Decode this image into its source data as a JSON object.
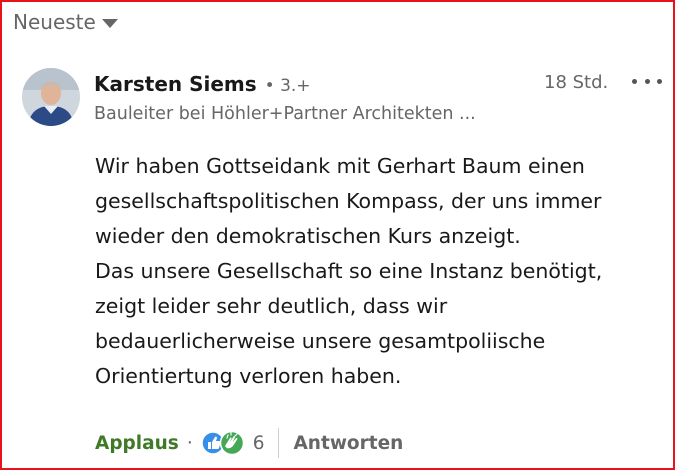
{
  "sort": {
    "label": "Neueste"
  },
  "comment": {
    "author": "Karsten Siems",
    "degree": "• 3.+",
    "headline": "Bauleiter bei Höhler+Partner Architekten ...",
    "time": "18 Std.",
    "body_lines": [
      "Wir haben Gottseidank mit Gerhart Baum einen",
      "gesellschaftspolitischen Kompass, der uns immer",
      "wieder den demokratischen Kurs anzeigt.",
      "Das unsere Gesellschaft so eine Instanz benötigt,",
      "zeigt leider sehr deutlich, dass wir",
      "bedauerlicherweise unsere gesamtpoliische",
      "Orientiertung verloren haben."
    ],
    "actions": {
      "react_label": "Applaus",
      "separator": "·",
      "reaction_count": "6",
      "reply_label": "Antworten"
    }
  },
  "colors": {
    "frame_border": "#e8141c",
    "applaus_green": "#3f7a28",
    "like_blue": "#378fe9",
    "applause_green_icon": "#44a855"
  },
  "icons": {
    "sort": "caret-down-icon",
    "more": "more-horizontal-icon",
    "reactions": [
      "like-reaction-icon",
      "applause-reaction-icon"
    ]
  }
}
